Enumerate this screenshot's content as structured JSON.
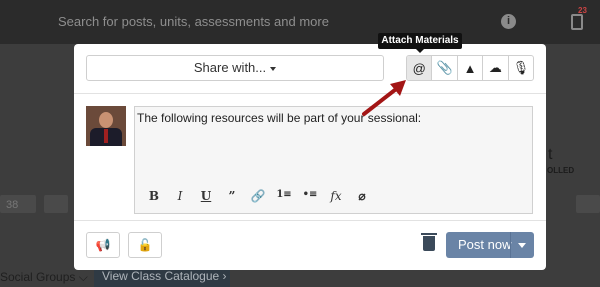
{
  "header": {
    "search_placeholder": "Search for posts, units, assessments and more",
    "info_icon_glyph": "i",
    "notification_count": "23"
  },
  "background": {
    "left_chip_text": "38",
    "right_letter": "t",
    "right_status": "OLLED",
    "social_groups": "Social Groups ⌵",
    "view_catalogue": "View Class Catalogue ›"
  },
  "modal": {
    "share_label": "Share with...",
    "toolbar": [
      {
        "icon": "at-icon",
        "glyph": "@"
      },
      {
        "icon": "paperclip-icon",
        "glyph": "📎"
      },
      {
        "icon": "google-drive-icon",
        "glyph": "▲"
      },
      {
        "icon": "onedrive-icon",
        "glyph": "☁"
      },
      {
        "icon": "microphone-icon",
        "glyph": "🎙"
      }
    ],
    "tooltip": "Attach Materials",
    "editor_text": "The following resources will be part of your sessional:",
    "format_buttons": [
      "B",
      "I",
      "U",
      "”",
      "🔗",
      "1≡",
      "•≡",
      "fx",
      "⌀"
    ],
    "post_label": "Post now",
    "footer_left": [
      {
        "icon": "megaphone-icon",
        "glyph": "📢"
      },
      {
        "icon": "unlock-icon",
        "glyph": "🔓"
      }
    ]
  },
  "colors": {
    "accent": "#6a84a6",
    "arrow": "#a31515"
  }
}
